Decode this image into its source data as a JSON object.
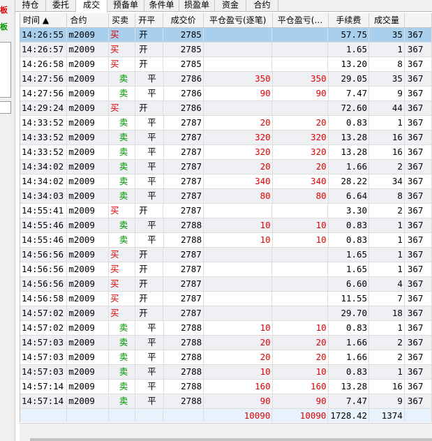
{
  "left_panel": {
    "tag_top": "板",
    "tag_bottom": "板"
  },
  "tabs": [
    "持仓",
    "委托",
    "成交",
    "预备单",
    "条件单",
    "损盈单",
    "资金",
    "合约"
  ],
  "active_tab": "成交",
  "columns": [
    "时间 ▲",
    "合约",
    "买卖",
    "开平",
    "成交价",
    "平仓盈亏(逐笔)",
    "平仓盈亏(…",
    "手续费",
    "成交量",
    ""
  ],
  "rows": [
    [
      "14:26:55",
      "m2009",
      "买",
      "开",
      "2785",
      "",
      "",
      "57.75",
      "35",
      "367"
    ],
    [
      "14:26:57",
      "m2009",
      "买",
      "开",
      "2785",
      "",
      "",
      "1.65",
      "1",
      "367"
    ],
    [
      "14:26:58",
      "m2009",
      "买",
      "开",
      "2785",
      "",
      "",
      "13.20",
      "8",
      "367"
    ],
    [
      "14:27:56",
      "m2009",
      "卖",
      "平",
      "2786",
      "350",
      "350",
      "29.05",
      "35",
      "367"
    ],
    [
      "14:27:56",
      "m2009",
      "卖",
      "平",
      "2786",
      "90",
      "90",
      "7.47",
      "9",
      "367"
    ],
    [
      "14:29:24",
      "m2009",
      "买",
      "开",
      "2786",
      "",
      "",
      "72.60",
      "44",
      "367"
    ],
    [
      "14:33:52",
      "m2009",
      "卖",
      "平",
      "2787",
      "20",
      "20",
      "0.83",
      "1",
      "367"
    ],
    [
      "14:33:52",
      "m2009",
      "卖",
      "平",
      "2787",
      "320",
      "320",
      "13.28",
      "16",
      "367"
    ],
    [
      "14:33:52",
      "m2009",
      "卖",
      "平",
      "2787",
      "320",
      "320",
      "13.28",
      "16",
      "367"
    ],
    [
      "14:34:02",
      "m2009",
      "卖",
      "平",
      "2787",
      "20",
      "20",
      "1.66",
      "2",
      "367"
    ],
    [
      "14:34:02",
      "m2009",
      "卖",
      "平",
      "2787",
      "340",
      "340",
      "28.22",
      "34",
      "367"
    ],
    [
      "14:34:03",
      "m2009",
      "卖",
      "平",
      "2787",
      "80",
      "80",
      "6.64",
      "8",
      "367"
    ],
    [
      "14:55:41",
      "m2009",
      "买",
      "开",
      "2787",
      "",
      "",
      "3.30",
      "2",
      "367"
    ],
    [
      "14:55:46",
      "m2009",
      "卖",
      "平",
      "2788",
      "10",
      "10",
      "0.83",
      "1",
      "367"
    ],
    [
      "14:55:46",
      "m2009",
      "卖",
      "平",
      "2788",
      "10",
      "10",
      "0.83",
      "1",
      "367"
    ],
    [
      "14:56:56",
      "m2009",
      "买",
      "开",
      "2787",
      "",
      "",
      "1.65",
      "1",
      "367"
    ],
    [
      "14:56:56",
      "m2009",
      "买",
      "开",
      "2787",
      "",
      "",
      "1.65",
      "1",
      "367"
    ],
    [
      "14:56:56",
      "m2009",
      "买",
      "开",
      "2787",
      "",
      "",
      "6.60",
      "4",
      "367"
    ],
    [
      "14:56:58",
      "m2009",
      "买",
      "开",
      "2787",
      "",
      "",
      "11.55",
      "7",
      "367"
    ],
    [
      "14:57:02",
      "m2009",
      "买",
      "开",
      "2787",
      "",
      "",
      "29.70",
      "18",
      "367"
    ],
    [
      "14:57:02",
      "m2009",
      "卖",
      "平",
      "2788",
      "10",
      "10",
      "0.83",
      "1",
      "367"
    ],
    [
      "14:57:03",
      "m2009",
      "卖",
      "平",
      "2788",
      "20",
      "20",
      "1.66",
      "2",
      "367"
    ],
    [
      "14:57:03",
      "m2009",
      "卖",
      "平",
      "2788",
      "20",
      "20",
      "1.66",
      "2",
      "367"
    ],
    [
      "14:57:03",
      "m2009",
      "卖",
      "平",
      "2788",
      "10",
      "10",
      "0.83",
      "1",
      "367"
    ],
    [
      "14:57:14",
      "m2009",
      "卖",
      "平",
      "2788",
      "160",
      "160",
      "13.28",
      "16",
      "367"
    ],
    [
      "14:57:14",
      "m2009",
      "卖",
      "平",
      "2788",
      "90",
      "90",
      "7.47",
      "9",
      "367"
    ]
  ],
  "totals": {
    "pnl_each": "10090",
    "pnl_other": "10090",
    "fee": "1728.42",
    "volume": "1374"
  },
  "selected_row": 0,
  "colors": {
    "buy": "#e00000",
    "sell": "#009600",
    "profit": "#e00000",
    "selected": "#a8d0ee",
    "tag_top": "#e00000",
    "tag_bottom": "#009600"
  }
}
